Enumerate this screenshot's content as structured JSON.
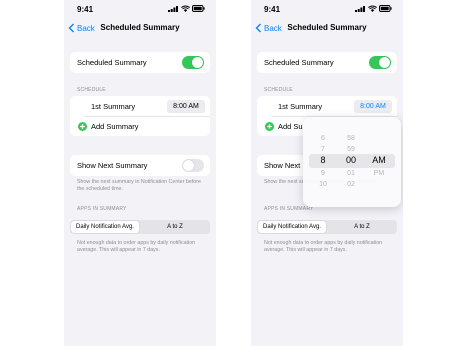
{
  "colors": {
    "accent": "#0a84ff",
    "toggle_on": "#34c759",
    "background": "#f2f2f7"
  },
  "icons": {
    "back": "chevron-left-icon",
    "add": "plus-circle-icon",
    "signal": "signal-icon",
    "wifi": "wifi-icon",
    "battery": "battery-icon"
  },
  "left": {
    "status": {
      "time": "9:41"
    },
    "nav": {
      "back_label": "Back",
      "title": "Scheduled Summary"
    },
    "scheduled_summary": {
      "label": "Scheduled Summary",
      "enabled": true
    },
    "schedule": {
      "header": "SCHEDULE",
      "summary_label": "1st Summary",
      "summary_time": "8:00 AM",
      "add_label": "Add Summary"
    },
    "show_next": {
      "label": "Show Next Summary",
      "enabled": false,
      "footer": "Show the next summary in Notification Center before the scheduled time."
    },
    "apps": {
      "header": "APPS IN SUMMARY",
      "segments": [
        "Daily Notification Avg.",
        "A to Z"
      ],
      "selected": 0,
      "footer": "Not enough data to order apps by daily notification average. This will appear in 7 days."
    }
  },
  "right": {
    "status": {
      "time": "9:41"
    },
    "nav": {
      "back_label": "Back",
      "title": "Scheduled Summary"
    },
    "scheduled_summary": {
      "label": "Scheduled Summary",
      "enabled": true
    },
    "schedule": {
      "header": "SCHEDULE",
      "summary_label": "1st Summary",
      "summary_time": "8:00 AM",
      "add_label": "Add Su"
    },
    "show_next": {
      "label": "Show Next",
      "footer": "Show the next summa... before the scheduled t..."
    },
    "apps": {
      "header": "APPS IN SUMMARY",
      "segments": [
        "Daily Notification Avg.",
        "A to Z"
      ],
      "selected": 0,
      "footer": "Not enough data to order apps by daily notification average. This will appear in 7 days."
    },
    "time_picker": {
      "hours": [
        "6",
        "7",
        "8",
        "9",
        "10"
      ],
      "minutes": [
        "58",
        "59",
        "00",
        "01",
        "02"
      ],
      "periods": [
        "AM",
        "PM"
      ],
      "selected": {
        "hour": "8",
        "minute": "00",
        "period": "AM"
      }
    }
  }
}
